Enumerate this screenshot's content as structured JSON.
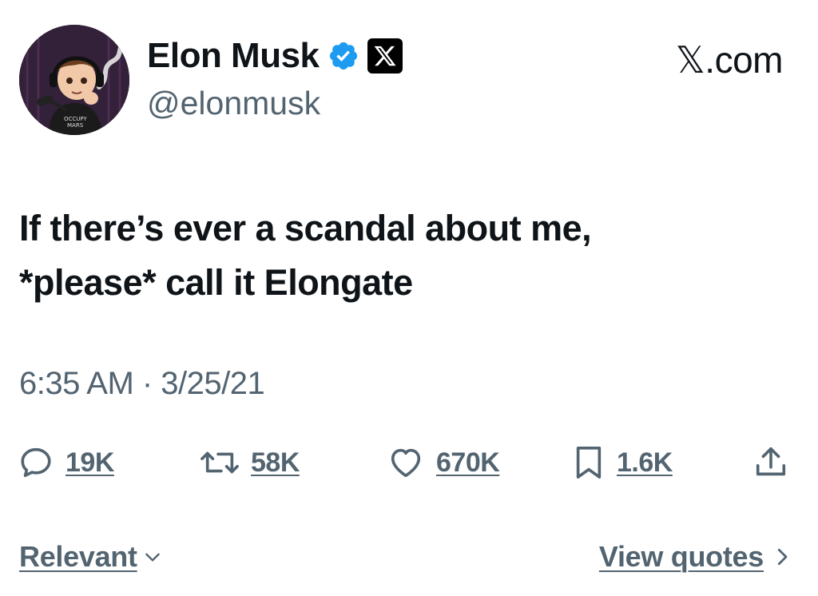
{
  "author": {
    "display_name": "Elon Musk",
    "handle": "@elonmusk",
    "verified_icon": "verified-badge-icon",
    "affiliation_icon": "x-logo-icon"
  },
  "site": "𝕏.com",
  "tweet": {
    "lines": [
      "If there’s ever a scandal about me,",
      "*please* call it Elongate"
    ],
    "timestamp": "6:35 AM · 3/25/21"
  },
  "metrics": {
    "replies": "19K",
    "reposts": "58K",
    "likes": "670K",
    "bookmarks": "1.6K"
  },
  "footer": {
    "sort_label": "Relevant",
    "view_quotes": "View quotes"
  },
  "colors": {
    "text": "#0f1419",
    "secondary": "#536471",
    "verified": "#1d9bf0"
  }
}
